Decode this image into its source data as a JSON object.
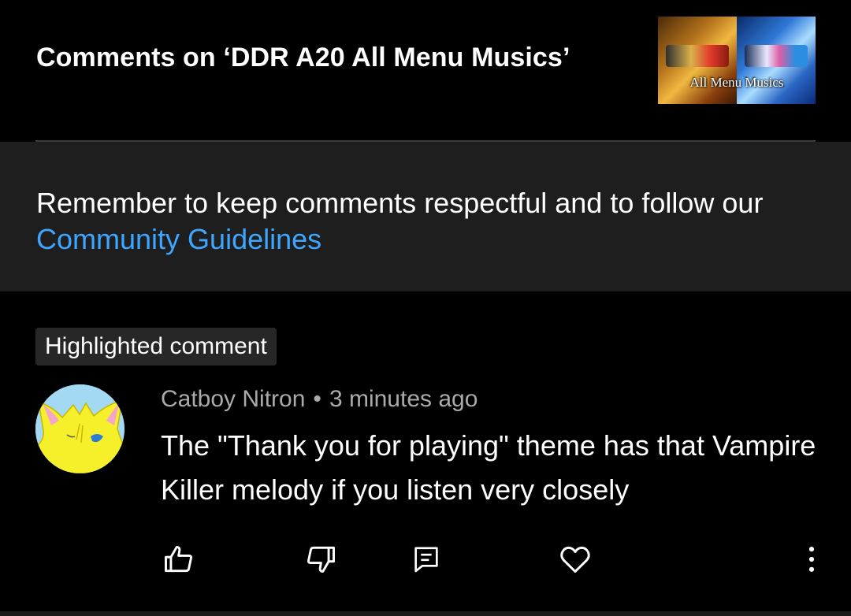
{
  "header": {
    "title": "Comments on ‘DDR A20 All Menu Musics’",
    "thumbnail_caption": "All Menu Musics"
  },
  "notice": {
    "text": "Remember to keep comments respectful and to follow our ",
    "link_label": "Community Guidelines"
  },
  "highlight_chip": "Highlighted comment",
  "comment": {
    "author": "Catboy Nitron",
    "separator": "•",
    "time": "3 minutes ago",
    "text": "The \"Thank you for playing\" theme has that Vampire Killer melody if you listen very closely"
  },
  "actions": {
    "icons": [
      "thumbs-up-icon",
      "thumbs-down-icon",
      "reply-icon",
      "heart-icon",
      "more-vert-icon"
    ]
  },
  "colors": {
    "background": "#000000",
    "notice_background": "#1e1e1e",
    "link": "#3ea6ff",
    "meta_text": "#aaaaaa",
    "chip_background": "#272727"
  }
}
